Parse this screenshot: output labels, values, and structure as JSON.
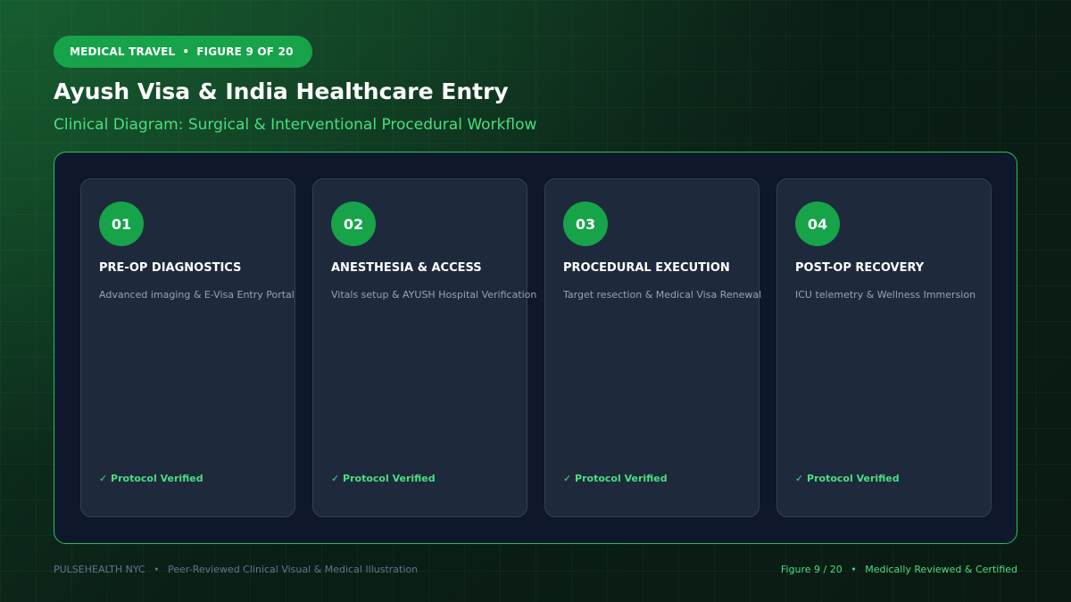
{
  "header": {
    "category": "MEDICAL TRAVEL",
    "figure_tag": "FIGURE 9 OF 20",
    "title": "Ayush Visa & India Healthcare Entry",
    "subtitle": "Clinical Diagram: Surgical & Interventional Procedural Workflow"
  },
  "steps": [
    {
      "number": "01",
      "title": "PRE-OP DIAGNOSTICS",
      "description": "Advanced imaging & E-Visa Entry Portal",
      "status": "✓ Protocol Verified"
    },
    {
      "number": "02",
      "title": "ANESTHESIA & ACCESS",
      "description": "Vitals setup & AYUSH Hospital Verification",
      "status": "✓ Protocol Verified"
    },
    {
      "number": "03",
      "title": "PROCEDURAL EXECUTION",
      "description": "Target resection & Medical Visa Renewal",
      "status": "✓ Protocol Verified"
    },
    {
      "number": "04",
      "title": "POST-OP RECOVERY",
      "description": "ICU telemetry & Wellness Immersion",
      "status": "✓ Protocol Verified"
    }
  ],
  "footer": {
    "brand": "PULSEHEALTH NYC",
    "tagline": "Peer-Reviewed Clinical Visual & Medical Illustration",
    "figure": "Figure 9 / 20",
    "certification": "Medically Reviewed & Certified"
  },
  "colors": {
    "accent": "#16a34a",
    "accent_text": "#4ade80",
    "panel": "#0f172a",
    "card": "#1e293b"
  }
}
